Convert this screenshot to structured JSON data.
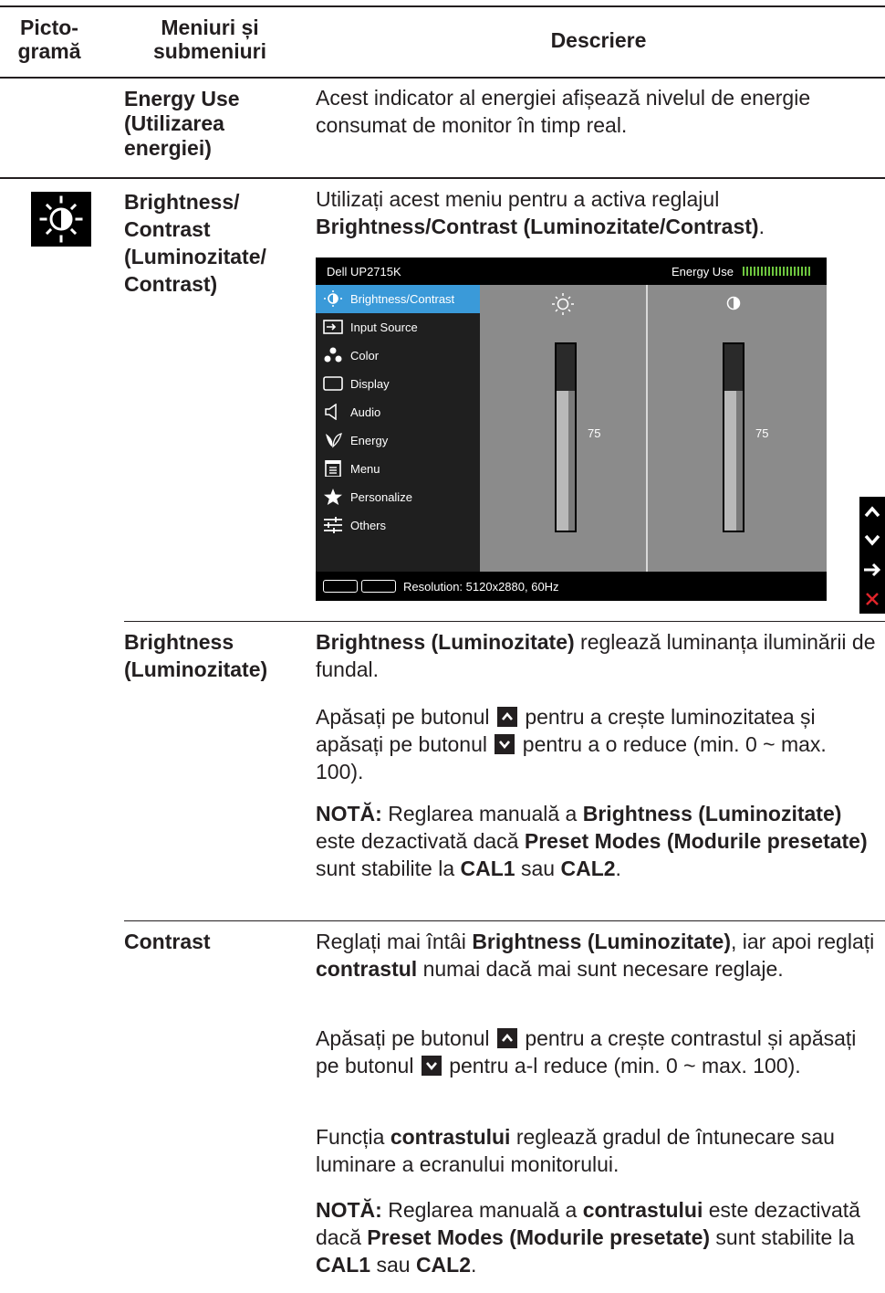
{
  "header": {
    "col1": "Picto-\ngramă",
    "col2": "Meniuri și\nsubmeniuri",
    "col3": "Descriere"
  },
  "rows": {
    "energy_use": {
      "name": "Energy Use\n(Utilizarea\nenergiei)",
      "desc": "Acest indicator al energiei afișează nivelul de energie consumat de monitor în timp real."
    },
    "brightness_contrast": {
      "icon": "brightness-contrast-icon",
      "name": "Brightness/\nContrast\n(Luminozitate/\nContrast)",
      "desc_a": "Utilizați acest meniu pentru a activa reglajul",
      "desc_b": "Brightness/Contrast (Luminozitate/Contrast)",
      "desc_c": "."
    },
    "brightness": {
      "name": "Brightness\n(Luminozitate)",
      "p1_b": "Brightness (Luminozitate)",
      "p1_t": " reglează luminanța iluminării de fundal.",
      "p2_a": "Apăsați pe butonul ",
      "p2_b": " pentru a crește luminozitatea și apăsați pe butonul ",
      "p2_c": " pentru a o reduce (min. 0 ~ max. 100).",
      "note_label": "NOTĂ:",
      "note_1": " Reglarea manuală a ",
      "note_b1": "Brightness (Luminozitate)",
      "note_2": " este dezactivată dacă ",
      "note_b2": "Preset Modes (Modurile presetate)",
      "note_3": " sunt stabilite la ",
      "note_b3": "CAL1",
      "note_4": " sau ",
      "note_b4": "CAL2",
      "note_5": "."
    },
    "contrast": {
      "name": "Contrast",
      "p1_a": "Reglați mai întâi ",
      "p1_b1": "Brightness (Luminozitate)",
      "p1_c": ", iar apoi reglați ",
      "p1_b2": "contrastul",
      "p1_d": " numai dacă mai sunt necesare reglaje.",
      "p2_a": "Apăsați pe butonul ",
      "p2_b": " pentru a crește contrastul și apăsați pe butonul ",
      "p2_c": " pentru a-l reduce (min. 0 ~ max. 100).",
      "p3_a": "Funcția ",
      "p3_b": "contrastului",
      "p3_c": " reglează gradul de întunecare sau luminare a ecranului monitorului.",
      "note_label": "NOTĂ:",
      "note_1": " Reglarea manuală a ",
      "note_b1": "contrastului",
      "note_2": " este dezactivată dacă ",
      "note_b2": "Preset Modes (Modurile presetate)",
      "note_3": " sunt stabilite la ",
      "note_b3": "CAL1",
      "note_4": " sau ",
      "note_b4": "CAL2",
      "note_5": "."
    }
  },
  "osd": {
    "model": "Dell UP2715K",
    "energy_label": "Energy Use",
    "menu": [
      {
        "label": "Brightness/Contrast",
        "icon": "brightness-contrast-icon",
        "selected": true
      },
      {
        "label": "Input Source",
        "icon": "input-source-icon",
        "selected": false
      },
      {
        "label": "Color",
        "icon": "color-icon",
        "selected": false
      },
      {
        "label": "Display",
        "icon": "display-icon",
        "selected": false
      },
      {
        "label": "Audio",
        "icon": "audio-icon",
        "selected": false
      },
      {
        "label": "Energy",
        "icon": "energy-icon",
        "selected": false
      },
      {
        "label": "Menu",
        "icon": "menu-icon",
        "selected": false
      },
      {
        "label": "Personalize",
        "icon": "star-icon",
        "selected": false
      },
      {
        "label": "Others",
        "icon": "others-icon",
        "selected": false
      }
    ],
    "brightness_value": "75",
    "contrast_value": "75",
    "level_fraction": 0.75,
    "resolution": "Resolution: 5120x2880, 60Hz",
    "nav_buttons": [
      "up-icon",
      "down-icon",
      "right-arrow-icon",
      "close-icon"
    ],
    "accent_color": "#3a9ad9",
    "close_color": "#e0242a"
  }
}
